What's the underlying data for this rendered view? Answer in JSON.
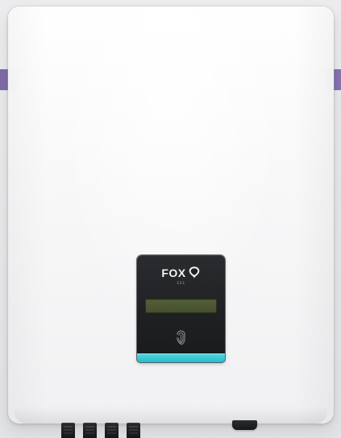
{
  "device": {
    "brand": "FOX",
    "brand_tagline": "ESS",
    "icons": {
      "logo": "fox-logo-icon",
      "touch": "fingerprint-touch-icon"
    }
  },
  "colors": {
    "accent": "#8a75b3",
    "status_strip": "#39c8d6",
    "panel": "#1f2023",
    "lcd": "#4d5833",
    "body": "#f4f4f5"
  }
}
